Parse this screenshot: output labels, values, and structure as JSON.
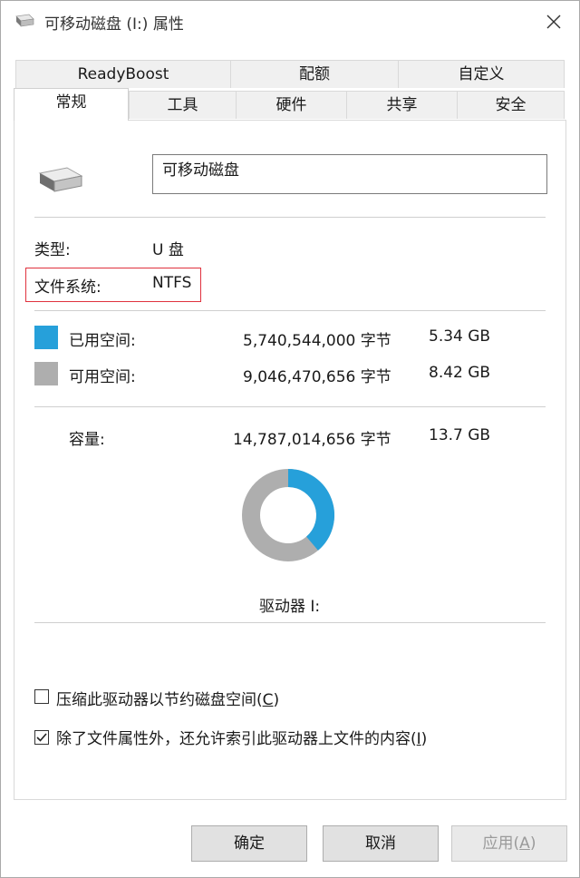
{
  "window": {
    "title": "可移动磁盘 (I:) 属性",
    "close_glyph": "✕"
  },
  "tabs_top": [
    "ReadyBoost",
    "配额",
    "自定义"
  ],
  "tabs_bottom": [
    "常规",
    "工具",
    "硬件",
    "共享",
    "安全"
  ],
  "general": {
    "drive_name": "可移动磁盘",
    "type_label": "类型:",
    "type_value": "U 盘",
    "fs_label": "文件系统:",
    "fs_value": "NTFS",
    "used_label": "已用空间:",
    "used_bytes": "5,740,544,000 字节",
    "used_gb": "5.34 GB",
    "free_label": "可用空间:",
    "free_bytes": "9,046,470,656 字节",
    "free_gb": "8.42 GB",
    "capacity_label": "容量:",
    "capacity_bytes": "14,787,014,656 字节",
    "capacity_gb": "13.7 GB",
    "drive_label": "驱动器 I:",
    "used_fraction": 0.388,
    "used_color": "#26a0da",
    "free_color": "#aeaeae"
  },
  "options": {
    "compress_label": "压缩此驱动器以节约磁盘空间(",
    "compress_key": "C",
    "compress_end": ")",
    "compress_checked": false,
    "index_label": "除了文件属性外，还允许索引此驱动器上文件的内容(",
    "index_key": "I",
    "index_end": ")",
    "index_checked": true
  },
  "buttons": {
    "ok": "确定",
    "cancel": "取消",
    "apply": "应用(",
    "apply_key": "A",
    "apply_end": ")"
  }
}
